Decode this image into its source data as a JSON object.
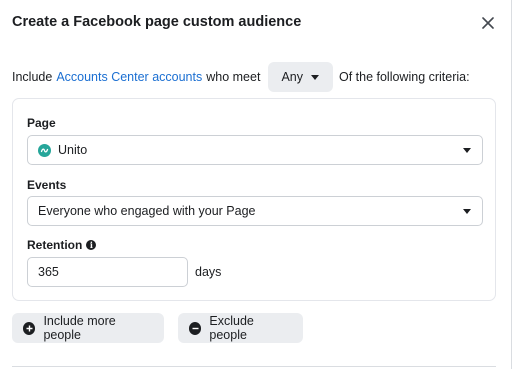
{
  "dialog": {
    "title": "Create a Facebook page custom audience",
    "close_icon": "close-icon"
  },
  "criteria": {
    "prefix": "Include",
    "accounts_link": "Accounts Center accounts",
    "middle": "who meet",
    "match_value": "Any",
    "suffix": "Of the following criteria:"
  },
  "rule": {
    "page_label": "Page",
    "page_value": "Unito",
    "page_icon": "unito-logo-icon",
    "events_label": "Events",
    "events_value": "Everyone who engaged with your Page",
    "retention_label": "Retention",
    "retention_value": "365",
    "retention_unit": "days"
  },
  "actions": {
    "include_label": "Include more people",
    "exclude_label": "Exclude people"
  },
  "colors": {
    "link": "#1b6fd2",
    "unito_brand": "#26a69a"
  }
}
